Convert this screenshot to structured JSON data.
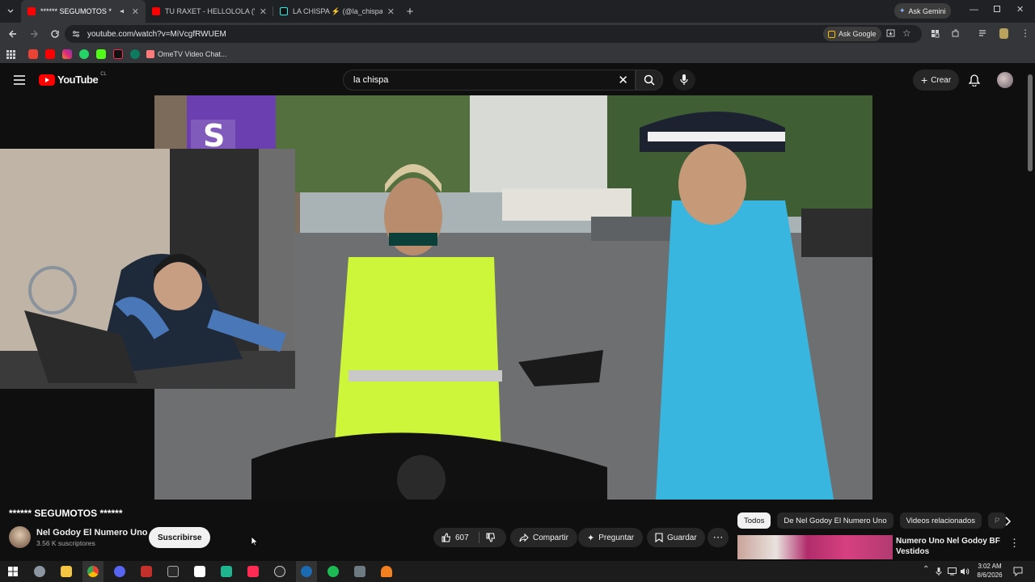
{
  "browser": {
    "tabs": [
      {
        "label": "****** SEGUMOTOS ******",
        "active": true
      },
      {
        "label": "TU RAXET - HELLOLOLA (VIDEO",
        "active": false
      },
      {
        "label": "LA CHISPA ⚡ (@la_chispa_ofic",
        "active": false
      }
    ],
    "ask_gemini": "Ask Gemini",
    "url": "youtube.com/watch?v=MiVcgfRWUEM",
    "ask_google": "Ask Google",
    "bookmark_label": "OmeTV Video Chat..."
  },
  "youtube": {
    "logo_text": "YouTube",
    "country": "CL",
    "search_value": "la chispa",
    "create_label": "Crear",
    "video_title": "****** SEGUMOTOS ******",
    "channel_name": "Nel Godoy El Numero Uno",
    "subscribers": "3.56 K suscriptores",
    "subscribe_label": "Suscribirse",
    "likes": "607",
    "share_label": "Compartir",
    "ask_label": "Preguntar",
    "save_label": "Guardar",
    "chips": [
      "Todos",
      "De Nel Godoy El Numero Uno",
      "Videos relacionados",
      "P"
    ],
    "related": {
      "title_line1": "Numero Uno Nel Godoy BF",
      "title_line2": "Vestidos"
    },
    "video_sign": "S"
  },
  "taskbar": {
    "time": "3:02 AM",
    "date": "8/6/2026"
  },
  "colors": {
    "yt_red": "#ff0000",
    "chrome_dark": "#202124",
    "chrome_toolbar": "#35363a"
  }
}
